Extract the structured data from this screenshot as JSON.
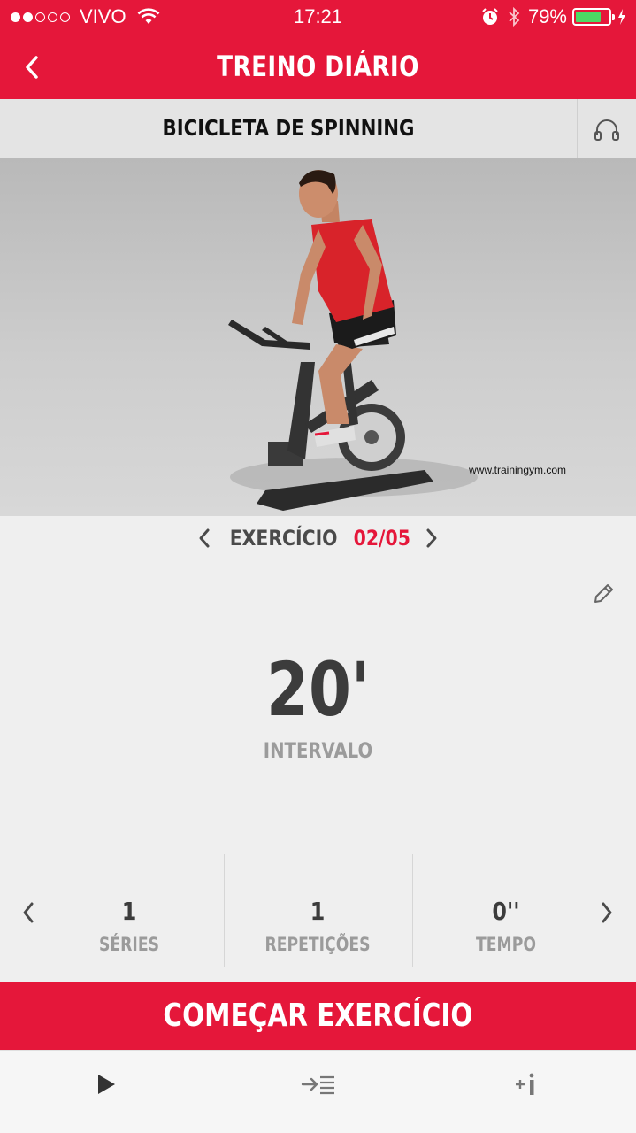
{
  "status_bar": {
    "carrier": "VIVO",
    "time": "17:21",
    "battery_percent": "79%",
    "battery_level": 0.79,
    "battery_color": "#4cd964"
  },
  "nav": {
    "title": "TREINO DIÁRIO",
    "back_icon": "chevron-left-icon"
  },
  "exercise": {
    "name": "BICICLETA DE SPINNING",
    "audio_icon": "headphones-icon",
    "watermark": "www.trainingym.com",
    "nav_label": "EXERCÍCIO",
    "counter": "02/05"
  },
  "interval": {
    "value": "20'",
    "label": "INTERVALO"
  },
  "stats": [
    {
      "value": "1",
      "label": "SÉRIES"
    },
    {
      "value": "1",
      "label": "REPETIÇÕES"
    },
    {
      "value": "0''",
      "label": "TEMPO"
    }
  ],
  "start_button": {
    "label": "COMEÇAR EXERCÍCIO"
  },
  "tab_bar": {
    "items": [
      {
        "icon": "play-icon"
      },
      {
        "icon": "indent-list-icon"
      },
      {
        "icon": "add-info-icon"
      }
    ]
  },
  "colors": {
    "brand_red": "#e5173a",
    "text_dark": "#3c3c3c",
    "text_muted": "#9b9b9b"
  }
}
